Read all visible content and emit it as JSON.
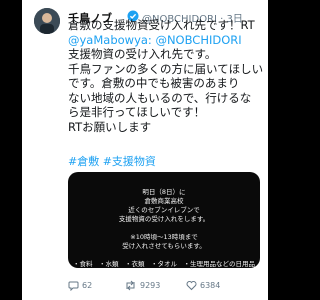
{
  "tweet": {
    "display_name": "千鳥ノブ",
    "handle_time": "@NOBCHIDORI · 3日",
    "body_lines": [
      "倉敷の支援物資受け入れ先です！RT",
      "@yaMabowya: @NOBCHIDORI",
      " 支援物資の受け入れ先です。",
      "千鳥ファンの多くの方に届いてほしい",
      "です。倉敷の中でも被害のあまり",
      "ない地域の人もいるので、行けるな",
      "ら是非行ってほしいです！",
      "RTお願いします"
    ],
    "hashtags": "#倉敷 #支援物資",
    "image_lines": [
      "明日（8日）に",
      "倉敷商業高校",
      "近くのセブンイレブンで",
      "支援物資の受け入れをします。",
      "",
      "※10時頃〜13時頃まで",
      "受け入れさせてもらいます。",
      "",
      "・食料　・水類　・衣類　・タオル　・生理用品などの日用品"
    ]
  },
  "actions": {
    "replies": "62",
    "retweets": "9293",
    "likes": "6384"
  },
  "colors": {
    "link": "#1da1f2",
    "muted": "#657786",
    "background": "#000000"
  },
  "icons": [
    "verified-badge-icon",
    "reply-icon",
    "retweet-icon",
    "like-icon"
  ]
}
